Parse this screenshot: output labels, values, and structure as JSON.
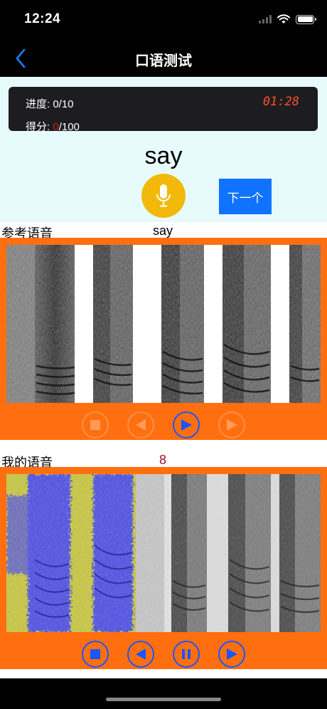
{
  "status_bar": {
    "time": "12:24",
    "icons": [
      "signal-icon",
      "wifi-icon",
      "battery-icon"
    ]
  },
  "nav": {
    "title": "口语测试",
    "back_icon": "chevron-left-icon"
  },
  "score_card": {
    "progress_label": "进度: 0/10",
    "score_label": "得分: ",
    "score_value": "0",
    "score_total": "/100",
    "timer": "01:28"
  },
  "word": "say",
  "buttons": {
    "record_icon": "microphone-icon",
    "next_label": "下一个"
  },
  "reference": {
    "label": "参考语音",
    "word": "say",
    "controls": [
      {
        "icon": "stop-icon",
        "enabled": false
      },
      {
        "icon": "rewind-icon",
        "enabled": false
      },
      {
        "icon": "play-icon",
        "enabled": true
      },
      {
        "icon": "forward-icon",
        "enabled": false
      }
    ]
  },
  "mine": {
    "label": "我的语音",
    "score": "8",
    "controls": [
      {
        "icon": "stop-icon",
        "enabled": true
      },
      {
        "icon": "rewind-icon",
        "enabled": true
      },
      {
        "icon": "pause-icon",
        "enabled": true
      },
      {
        "icon": "play-icon",
        "enabled": true
      }
    ]
  },
  "colors": {
    "accent_orange": "#ff6f10",
    "accent_blue": "#1073ff",
    "mic_yellow": "#f2b90a",
    "timer_red": "#ff5030",
    "highlight_blue": "#4a4ae8",
    "highlight_yellow": "#c9c93a"
  }
}
